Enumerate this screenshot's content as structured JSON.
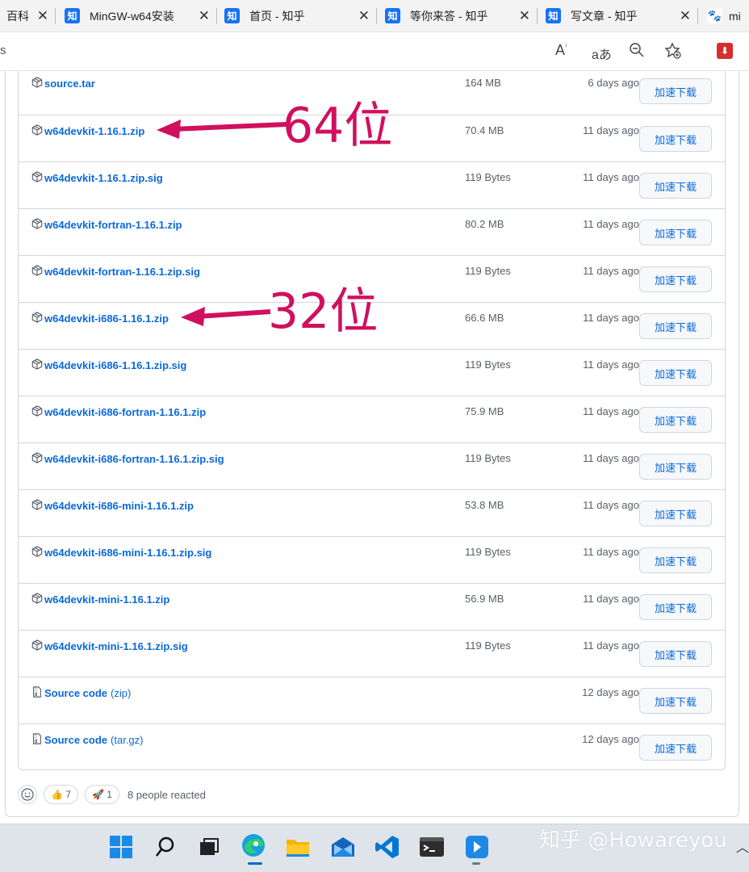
{
  "browser": {
    "tabs": [
      {
        "label": "百科",
        "icon": "",
        "closable": true
      },
      {
        "label": "MinGW-w64安装",
        "icon": "zhihu-icon",
        "closable": true
      },
      {
        "label": "首页 - 知乎",
        "icon": "zhihu-icon",
        "closable": true
      },
      {
        "label": "等你来答 - 知乎",
        "icon": "zhihu-icon",
        "closable": true
      },
      {
        "label": "写文章 - 知乎",
        "icon": "zhihu-icon",
        "closable": true
      },
      {
        "label": "mi",
        "icon": "baidu-icon",
        "closable": false
      }
    ],
    "zhihu_glyph": "知",
    "close_glyph": "✕",
    "address_text": "s",
    "toolbar_icons": [
      "read-aloud-icon",
      "translate-icon",
      "zoom-out-icon",
      "favorites-icon",
      "extension-icon"
    ]
  },
  "assets": [
    {
      "name": "source.tar",
      "suffix": "",
      "type": "package",
      "size": "164 MB",
      "time": "6 days ago",
      "button": "加速下载"
    },
    {
      "name": "w64devkit-1.16.1.zip",
      "suffix": "",
      "type": "package",
      "size": "70.4 MB",
      "time": "11 days ago",
      "button": "加速下载"
    },
    {
      "name": "w64devkit-1.16.1.zip.sig",
      "suffix": "",
      "type": "package",
      "size": "119 Bytes",
      "time": "11 days ago",
      "button": "加速下载"
    },
    {
      "name": "w64devkit-fortran-1.16.1.zip",
      "suffix": "",
      "type": "package",
      "size": "80.2 MB",
      "time": "11 days ago",
      "button": "加速下载"
    },
    {
      "name": "w64devkit-fortran-1.16.1.zip.sig",
      "suffix": "",
      "type": "package",
      "size": "119 Bytes",
      "time": "11 days ago",
      "button": "加速下载"
    },
    {
      "name": "w64devkit-i686-1.16.1.zip",
      "suffix": "",
      "type": "package",
      "size": "66.6 MB",
      "time": "11 days ago",
      "button": "加速下载"
    },
    {
      "name": "w64devkit-i686-1.16.1.zip.sig",
      "suffix": "",
      "type": "package",
      "size": "119 Bytes",
      "time": "11 days ago",
      "button": "加速下载"
    },
    {
      "name": "w64devkit-i686-fortran-1.16.1.zip",
      "suffix": "",
      "type": "package",
      "size": "75.9 MB",
      "time": "11 days ago",
      "button": "加速下载"
    },
    {
      "name": "w64devkit-i686-fortran-1.16.1.zip.sig",
      "suffix": "",
      "type": "package",
      "size": "119 Bytes",
      "time": "11 days ago",
      "button": "加速下载"
    },
    {
      "name": "w64devkit-i686-mini-1.16.1.zip",
      "suffix": "",
      "type": "package",
      "size": "53.8 MB",
      "time": "11 days ago",
      "button": "加速下载"
    },
    {
      "name": "w64devkit-i686-mini-1.16.1.zip.sig",
      "suffix": "",
      "type": "package",
      "size": "119 Bytes",
      "time": "11 days ago",
      "button": "加速下载"
    },
    {
      "name": "w64devkit-mini-1.16.1.zip",
      "suffix": "",
      "type": "package",
      "size": "56.9 MB",
      "time": "11 days ago",
      "button": "加速下载"
    },
    {
      "name": "w64devkit-mini-1.16.1.zip.sig",
      "suffix": "",
      "type": "package",
      "size": "119 Bytes",
      "time": "11 days ago",
      "button": "加速下载"
    },
    {
      "name": "Source code",
      "suffix": "(zip)",
      "type": "source",
      "size": "",
      "time": "12 days ago",
      "button": "加速下载"
    },
    {
      "name": "Source code",
      "suffix": "(tar.gz)",
      "type": "source",
      "size": "",
      "time": "12 days ago",
      "button": "加速下载"
    }
  ],
  "annotations": [
    {
      "text": "64位",
      "color": "#d0105f"
    },
    {
      "text": "32位",
      "color": "#d0105f"
    }
  ],
  "reactions": {
    "thumbs_up_count": "7",
    "rocket_count": "1",
    "summary": "8 people reacted"
  },
  "taskbar": {
    "icons": [
      "start-icon",
      "search-icon",
      "task-view-icon",
      "edge-icon",
      "file-explorer-icon",
      "mail-icon",
      "vscode-icon",
      "terminal-icon",
      "app-icon"
    ],
    "watermark": "知乎 @Howareyou"
  }
}
